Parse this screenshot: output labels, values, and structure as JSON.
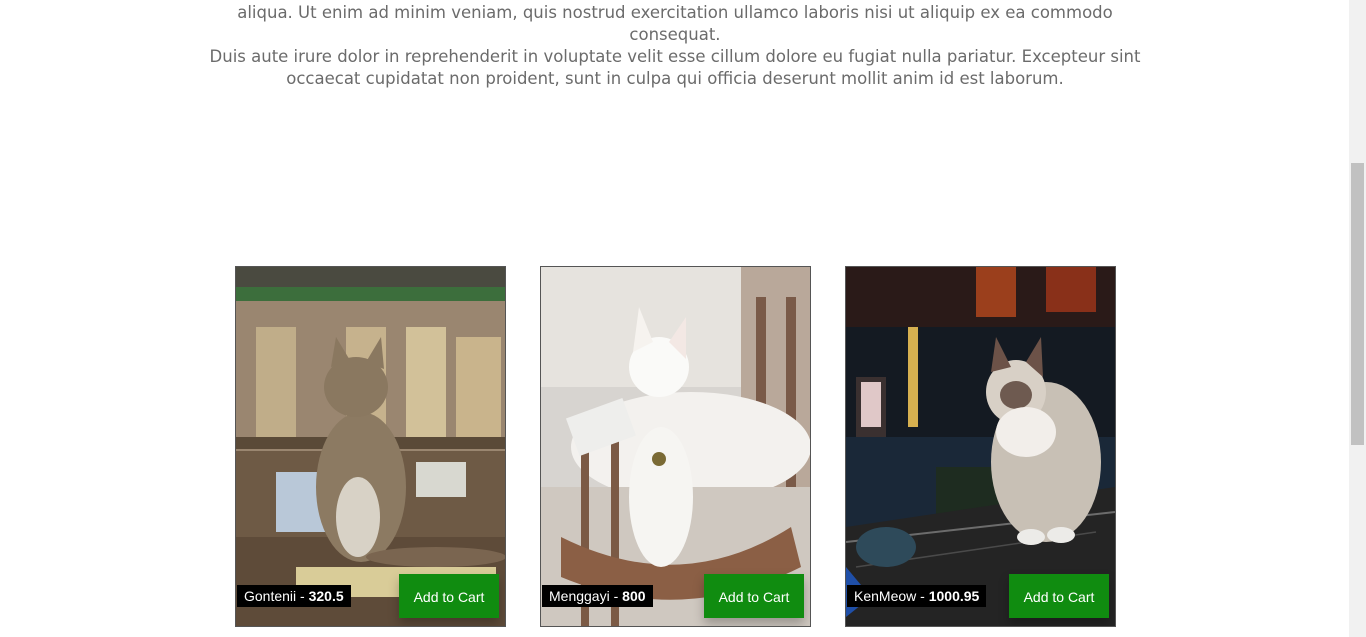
{
  "intro": {
    "lines": [
      "aliqua. Ut enim ad minim veniam, quis nostrud exercitation ullamco laboris nisi ut aliquip ex ea commodo consequat.",
      "Duis aute irure dolor in reprehenderit in voluptate velit esse cillum dolore eu fugiat nulla pariatur. Excepteur sint",
      "occaecat cupidatat non proident, sunt in culpa qui officia deserunt mollit anim id est laborum."
    ]
  },
  "products": [
    {
      "name": "Gontenii",
      "separator": " - ",
      "price": "320.5",
      "button_label": "Add to Cart",
      "photo_icon": "tabby-cat-photo"
    },
    {
      "name": "Menggayi",
      "separator": " - ",
      "price": "800",
      "button_label": "Add to Cart",
      "photo_icon": "white-cat-photo"
    },
    {
      "name": "KenMeow",
      "separator": " - ",
      "price": "1000.95",
      "button_label": "Add to Cart",
      "photo_icon": "ragdoll-cat-photo"
    }
  ],
  "colors": {
    "button": "#108c10",
    "caption_bg": "#000000",
    "text": "#6b6b6b"
  }
}
